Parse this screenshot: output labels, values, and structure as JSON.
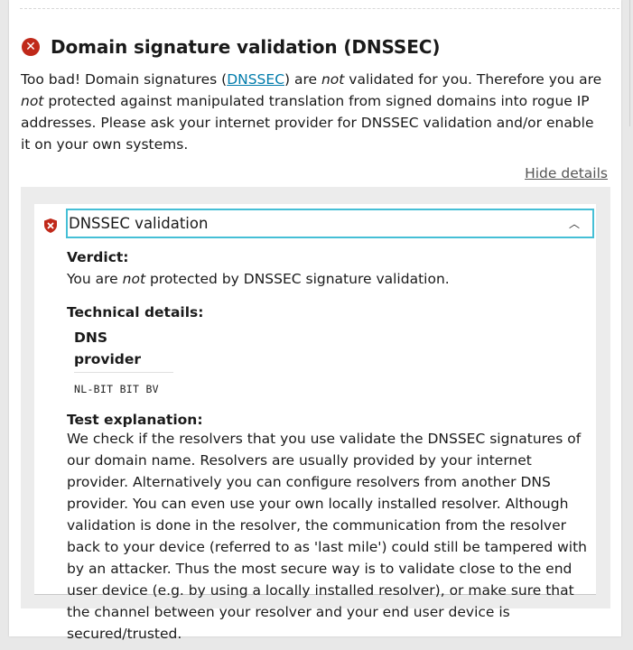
{
  "section": {
    "heading": "Domain signature validation (DNSSEC)",
    "intro": {
      "part1": "Too bad! Domain signatures (",
      "link": "DNSSEC",
      "part2": ") are ",
      "em1": "not",
      "part3": " validated for you. Therefore you are ",
      "em2": "not",
      "part4": " protected against manipulated translation from signed domains into rogue IP addresses. Please ask your internet provider for DNSSEC validation and/or enable it on your own systems."
    },
    "hide_details": "Hide details"
  },
  "details": {
    "title": "DNSSEC validation",
    "verdict_label": "Verdict:",
    "verdict": {
      "part1": "You are ",
      "em": "not",
      "part2": " protected by DNSSEC signature validation."
    },
    "technical_label": "Technical details:",
    "table": {
      "header": "DNS provider",
      "rows": [
        "NL-BIT BIT BV"
      ]
    },
    "explanation_label": "Test explanation:",
    "explanation": "We check if the resolvers that you use validate the DNSSEC signatures of our domain name. Resolvers are usually provided by your internet provider. Alternatively you can configure resolvers from another DNS provider. You can even use your own locally installed resolver. Although validation is done in the resolver, the communication from the resolver back to your device (referred to as 'last mile') could still be tampered with by an attacker. Thus the most secure way is to validate close to the end user device (e.g. by using a locally installed resolver), or make sure that the channel between your resolver and your end user device is secured/trusted."
  },
  "icons": {
    "status": "error-x-icon",
    "shield": "shield-x-icon",
    "chevron": "chevron-up-icon"
  },
  "colors": {
    "error": "#c0291a",
    "link": "#007bab",
    "focus": "#45bfd6"
  }
}
